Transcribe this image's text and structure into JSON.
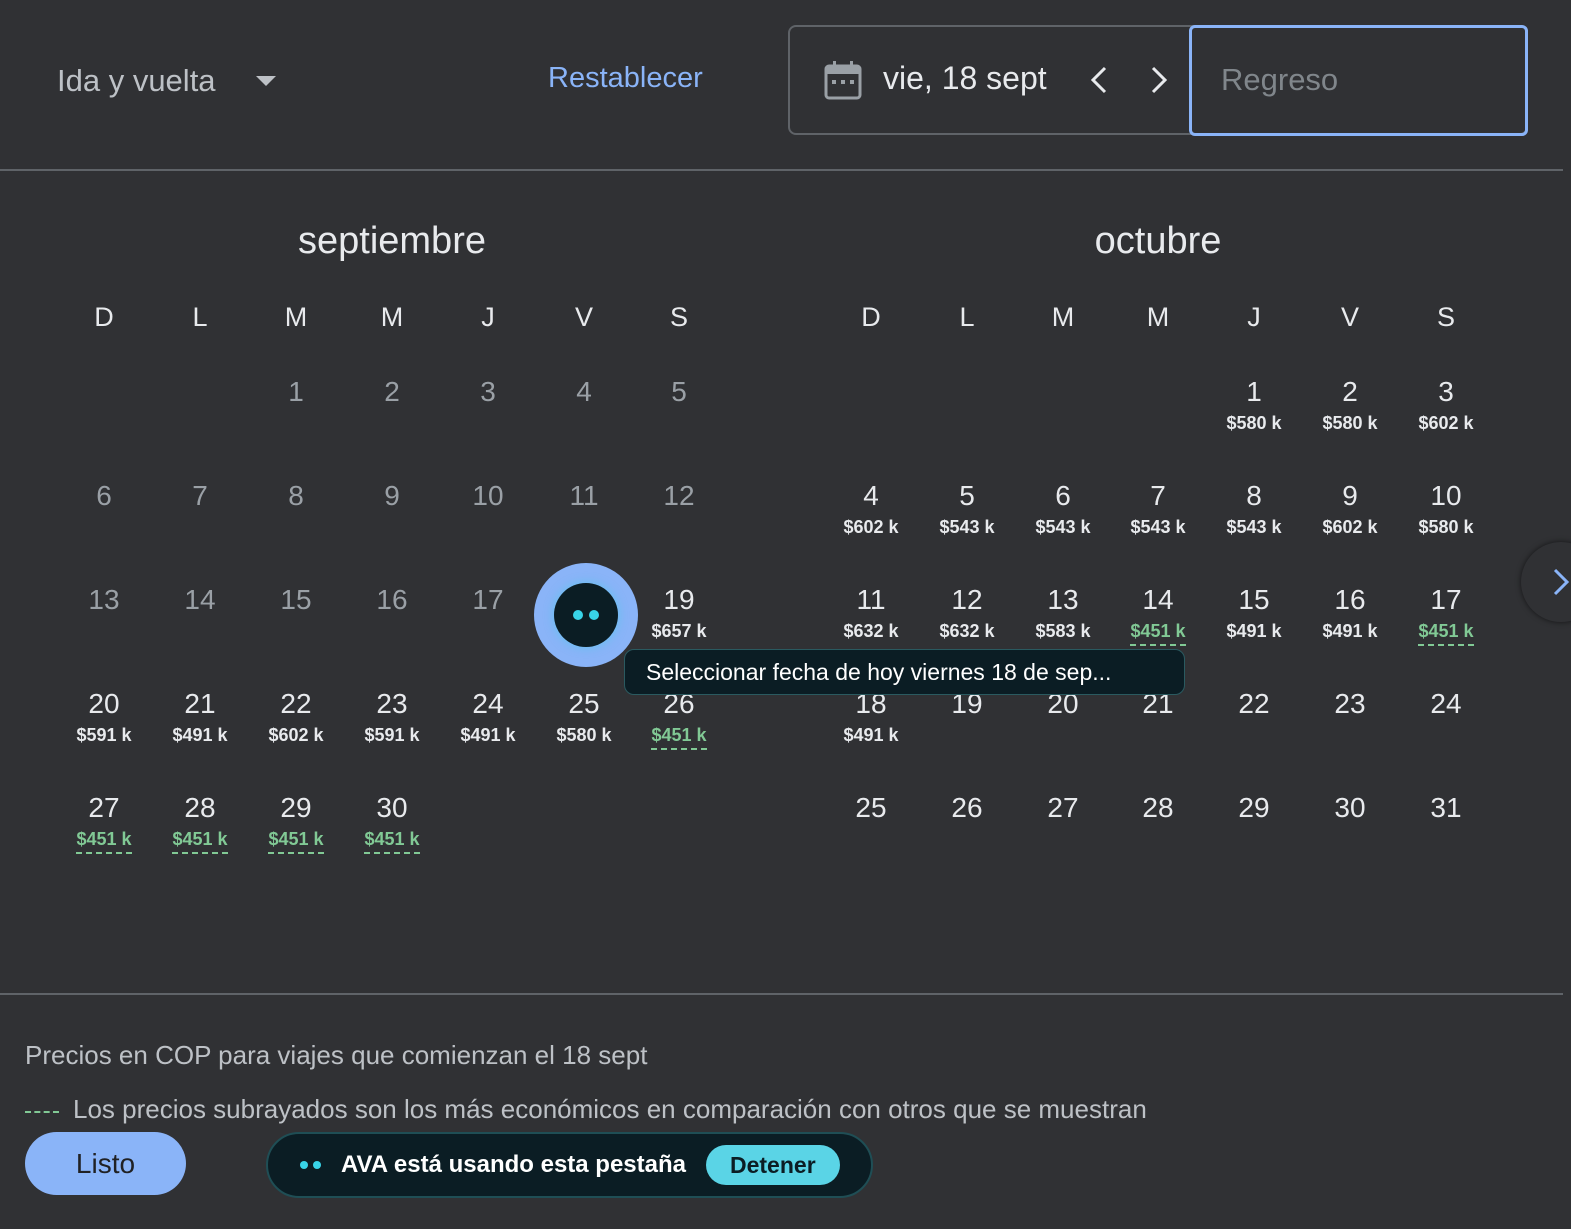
{
  "header": {
    "trip_type": "Ida y vuelta",
    "reset_label": "Restablecer",
    "departure_date": "vie, 18 sept",
    "return_placeholder": "Regreso"
  },
  "calendar": {
    "weekdays": [
      "D",
      "L",
      "M",
      "M",
      "J",
      "V",
      "S"
    ],
    "months": [
      {
        "name": "septiembre",
        "weeks": [
          [
            null,
            null,
            {
              "day": "1",
              "past": true
            },
            {
              "day": "2",
              "past": true
            },
            {
              "day": "3",
              "past": true
            },
            {
              "day": "4",
              "past": true
            },
            {
              "day": "5",
              "past": true
            }
          ],
          [
            {
              "day": "6",
              "past": true
            },
            {
              "day": "7",
              "past": true
            },
            {
              "day": "8",
              "past": true
            },
            {
              "day": "9",
              "past": true
            },
            {
              "day": "10",
              "past": true
            },
            {
              "day": "11",
              "past": true
            },
            {
              "day": "12",
              "past": true
            }
          ],
          [
            {
              "day": "13",
              "past": true
            },
            {
              "day": "14",
              "past": true
            },
            {
              "day": "15",
              "past": true
            },
            {
              "day": "16",
              "past": true
            },
            {
              "day": "17",
              "past": true
            },
            {
              "day": "18",
              "selected": true
            },
            {
              "day": "19",
              "price": "$657 k"
            }
          ],
          [
            {
              "day": "20",
              "price": "$591 k"
            },
            {
              "day": "21",
              "price": "$491 k"
            },
            {
              "day": "22",
              "price": "$602 k"
            },
            {
              "day": "23",
              "price": "$591 k"
            },
            {
              "day": "24",
              "price": "$491 k"
            },
            {
              "day": "25",
              "price": "$580 k"
            },
            {
              "day": "26",
              "price": "$451 k",
              "cheap": true
            }
          ],
          [
            {
              "day": "27",
              "price": "$451 k",
              "cheap": true
            },
            {
              "day": "28",
              "price": "$451 k",
              "cheap": true
            },
            {
              "day": "29",
              "price": "$451 k",
              "cheap": true
            },
            {
              "day": "30",
              "price": "$451 k",
              "cheap": true
            },
            null,
            null,
            null
          ]
        ]
      },
      {
        "name": "octubre",
        "weeks": [
          [
            null,
            null,
            null,
            null,
            {
              "day": "1",
              "price": "$580 k"
            },
            {
              "day": "2",
              "price": "$580 k"
            },
            {
              "day": "3",
              "price": "$602 k"
            }
          ],
          [
            {
              "day": "4",
              "price": "$602 k"
            },
            {
              "day": "5",
              "price": "$543 k"
            },
            {
              "day": "6",
              "price": "$543 k"
            },
            {
              "day": "7",
              "price": "$543 k"
            },
            {
              "day": "8",
              "price": "$543 k"
            },
            {
              "day": "9",
              "price": "$602 k"
            },
            {
              "day": "10",
              "price": "$580 k"
            }
          ],
          [
            {
              "day": "11",
              "price": "$632 k"
            },
            {
              "day": "12",
              "price": "$632 k"
            },
            {
              "day": "13",
              "price": "$583 k"
            },
            {
              "day": "14",
              "price": "$451 k",
              "cheap": true
            },
            {
              "day": "15",
              "price": "$491 k"
            },
            {
              "day": "16",
              "price": "$491 k"
            },
            {
              "day": "17",
              "price": "$451 k",
              "cheap": true
            }
          ],
          [
            {
              "day": "18",
              "price": "$491 k"
            },
            {
              "day": "19"
            },
            {
              "day": "20"
            },
            {
              "day": "21"
            },
            {
              "day": "22"
            },
            {
              "day": "23"
            },
            {
              "day": "24"
            }
          ],
          [
            {
              "day": "25"
            },
            {
              "day": "26"
            },
            {
              "day": "27"
            },
            {
              "day": "28"
            },
            {
              "day": "29"
            },
            {
              "day": "30"
            },
            {
              "day": "31"
            }
          ]
        ]
      }
    ]
  },
  "tooltip": "Seleccionar fecha de hoy viernes 18 de sep...",
  "footer": {
    "currency_note": "Precios en COP para viajes que comienzan el 18 sept",
    "legend_text": "Los precios subrayados son los más económicos en comparación con otros que se muestran",
    "done_label": "Listo"
  },
  "ava": {
    "status_text": "AVA está usando esta pestaña",
    "stop_label": "Detener"
  },
  "colors": {
    "background": "#303134",
    "accent": "#8ab4f8",
    "cheap_price": "#81c995",
    "ava_cyan": "#38d4e8"
  }
}
